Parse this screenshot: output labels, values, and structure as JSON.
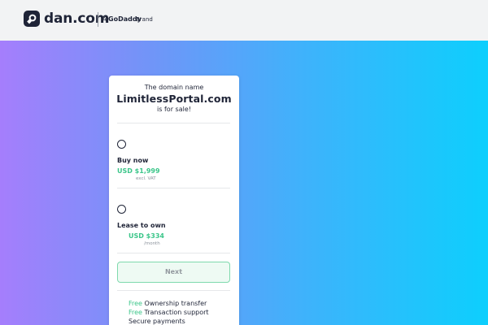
{
  "header": {
    "logo_text": "dan.com",
    "brand_prefix": "A",
    "brand_name": "GoDaddy",
    "brand_suffix": "Brand"
  },
  "card": {
    "intro": "The domain name",
    "domain": "LimitlessPortal.com",
    "sale_text": "is for sale!",
    "options": [
      {
        "title": "Buy now",
        "price": "USD $1,999",
        "note": "excl. VAT"
      },
      {
        "title": "Lease to own",
        "price": "USD $334",
        "note": "/month"
      }
    ],
    "next_label": "Next",
    "features": [
      {
        "free": "Free",
        "label": "Ownership transfer"
      },
      {
        "free": "Free",
        "label": "Transaction support"
      },
      {
        "free": "",
        "label": "Secure payments"
      }
    ]
  },
  "colors": {
    "accent_green": "#3cc68a",
    "text_dark": "#1f2437",
    "gradient_start": "#a57efc",
    "gradient_end": "#0dcffd"
  }
}
